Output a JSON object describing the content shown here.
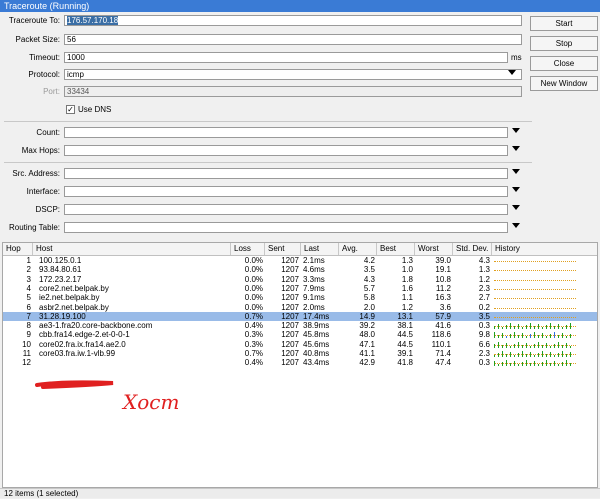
{
  "window": {
    "title": "Traceroute (Running)"
  },
  "buttons": {
    "start": "Start",
    "stop": "Stop",
    "close": "Close",
    "new_window": "New Window"
  },
  "form": {
    "traceroute_to": {
      "label": "Traceroute To:",
      "value": "176.57.170.18"
    },
    "packet_size": {
      "label": "Packet Size:",
      "value": "56"
    },
    "timeout": {
      "label": "Timeout:",
      "value": "1000",
      "unit": "ms"
    },
    "protocol": {
      "label": "Protocol:",
      "value": "icmp"
    },
    "port": {
      "label": "Port:",
      "value": "33434"
    },
    "use_dns": {
      "label": "Use DNS",
      "checked": true
    },
    "count": {
      "label": "Count:"
    },
    "max_hops": {
      "label": "Max Hops:"
    },
    "src_address": {
      "label": "Src. Address:"
    },
    "interface": {
      "label": "Interface:"
    },
    "dscp": {
      "label": "DSCP:"
    },
    "routing_table": {
      "label": "Routing Table:"
    }
  },
  "table": {
    "columns": [
      "Hop",
      "Host",
      "Loss",
      "Sent",
      "Last",
      "Avg.",
      "Best",
      "Worst",
      "Std. Dev.",
      "History"
    ],
    "rows": [
      {
        "hop": "1",
        "host": "100.125.0.1",
        "loss": "0.0%",
        "sent": "1207",
        "last": "2.1ms",
        "avg": "4.2",
        "best": "1.3",
        "worst": "39.0",
        "std": "4.3"
      },
      {
        "hop": "2",
        "host": "93.84.80.61",
        "loss": "0.0%",
        "sent": "1207",
        "last": "4.6ms",
        "avg": "3.5",
        "best": "1.0",
        "worst": "19.1",
        "std": "1.3"
      },
      {
        "hop": "3",
        "host": "172.23.2.17",
        "loss": "0.0%",
        "sent": "1207",
        "last": "3.3ms",
        "avg": "4.3",
        "best": "1.8",
        "worst": "10.8",
        "std": "1.2"
      },
      {
        "hop": "4",
        "host": "core2.net.belpak.by",
        "loss": "0.0%",
        "sent": "1207",
        "last": "7.9ms",
        "avg": "5.7",
        "best": "1.6",
        "worst": "11.2",
        "std": "2.3"
      },
      {
        "hop": "5",
        "host": "ie2.net.belpak.by",
        "loss": "0.0%",
        "sent": "1207",
        "last": "9.1ms",
        "avg": "5.8",
        "best": "1.1",
        "worst": "16.3",
        "std": "2.7"
      },
      {
        "hop": "6",
        "host": "asbr2.net.belpak.by",
        "loss": "0.0%",
        "sent": "1207",
        "last": "2.0ms",
        "avg": "2.0",
        "best": "1.2",
        "worst": "3.6",
        "std": "0.2"
      },
      {
        "hop": "7",
        "host": "31.28.19.100",
        "loss": "0.7%",
        "sent": "1207",
        "last": "17.4ms",
        "avg": "14.9",
        "best": "13.1",
        "worst": "57.9",
        "std": "3.5",
        "selected": true
      },
      {
        "hop": "8",
        "host": "ae3-1.fra20.core-backbone.com",
        "loss": "0.4%",
        "sent": "1207",
        "last": "38.9ms",
        "avg": "39.2",
        "best": "38.1",
        "worst": "41.6",
        "std": "0.3"
      },
      {
        "hop": "9",
        "host": "cbb.fra14.edge-2.et-0-0-1",
        "loss": "0.3%",
        "sent": "1207",
        "last": "45.8ms",
        "avg": "48.0",
        "best": "44.5",
        "worst": "118.6",
        "std": "9.8"
      },
      {
        "hop": "10",
        "host": "core02.fra.ix.fra14.ae2.0",
        "loss": "0.3%",
        "sent": "1207",
        "last": "45.6ms",
        "avg": "47.1",
        "best": "44.5",
        "worst": "110.1",
        "std": "6.6"
      },
      {
        "hop": "11",
        "host": "core03.fra.iw.1-vlb.99",
        "loss": "0.7%",
        "sent": "1207",
        "last": "40.8ms",
        "avg": "41.1",
        "best": "39.1",
        "worst": "71.4",
        "std": "2.3"
      },
      {
        "hop": "12",
        "host": "",
        "loss": "0.4%",
        "sent": "1207",
        "last": "43.4ms",
        "avg": "42.9",
        "best": "41.8",
        "worst": "47.4",
        "std": "0.3"
      }
    ]
  },
  "annotation": {
    "text": "Хост",
    "color": "#e02020"
  },
  "status": {
    "text": "12 items (1 selected)"
  },
  "colors": {
    "titlebar": "#3a7bd5",
    "selection": "#99bbe8",
    "history_ok": "#e0a020",
    "history_green": "#20a020",
    "history_blue": "#3070e0",
    "redaction": "#e02020"
  }
}
